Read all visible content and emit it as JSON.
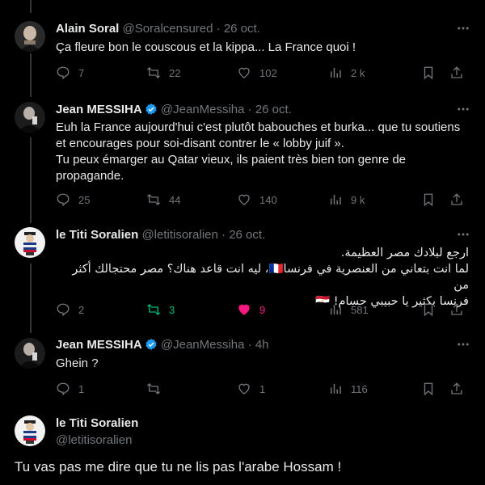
{
  "colors": {
    "background": "#000000",
    "text": "#e7e9ea",
    "muted": "#71767b",
    "retweet_active": "#00ba7c",
    "like_active": "#f91880",
    "verified": "#1d9bf0"
  },
  "tweets": [
    {
      "name": "Alain Soral",
      "handle": "@Soralcensured",
      "date": "· 26 oct.",
      "text": "Ça fleure bon le couscous et la kippa... La France quoi !",
      "replies": "7",
      "retweets": "22",
      "likes": "102",
      "views": "2 k"
    },
    {
      "name": "Jean MESSIHA",
      "handle": "@JeanMessiha",
      "date": "· 26 oct.",
      "verified": true,
      "text_lines": [
        "Euh la France aujourd'hui c'est plutôt babouches et burka... que tu soutiens",
        "et encourages pour soi-disant contrer le « lobby juif ».",
        "Tu peux émarger au Qatar vieux, ils paient très bien ton genre de",
        "propagande."
      ],
      "replies": "25",
      "retweets": "44",
      "likes": "140",
      "views": "9 k"
    },
    {
      "name": "le Titi Soralien",
      "handle": "@letitisoralien",
      "date": "· 26 oct.",
      "text_lines": [
        "ارجع لبلادك مصر العظيمة.",
        "لما انت بتعاني من العنصرية في فرنسا🇫🇷، ليه انت قاعد هناك؟ مصر محتجالك أكثر من",
        "فرنسا بكثير يا حبيبي حسام! 🇪🇬"
      ],
      "replies": "2",
      "retweets": "3",
      "likes": "9",
      "views": "581",
      "retweeted": true,
      "liked": true
    },
    {
      "name": "Jean MESSIHA",
      "handle": "@JeanMessiha",
      "date": "· 4h",
      "verified": true,
      "text": "Ghein ?",
      "replies": "1",
      "retweets": "",
      "likes": "1",
      "views": "116"
    },
    {
      "name": "le Titi Soralien",
      "handle": "@letitisoralien",
      "text": "Tu vas pas me dire que tu ne lis pas l'arabe Hossam !"
    }
  ],
  "icons": [
    "reply-icon",
    "retweet-icon",
    "like-icon",
    "views-icon",
    "bookmark-icon",
    "share-icon",
    "more-icon",
    "verified-icon"
  ]
}
